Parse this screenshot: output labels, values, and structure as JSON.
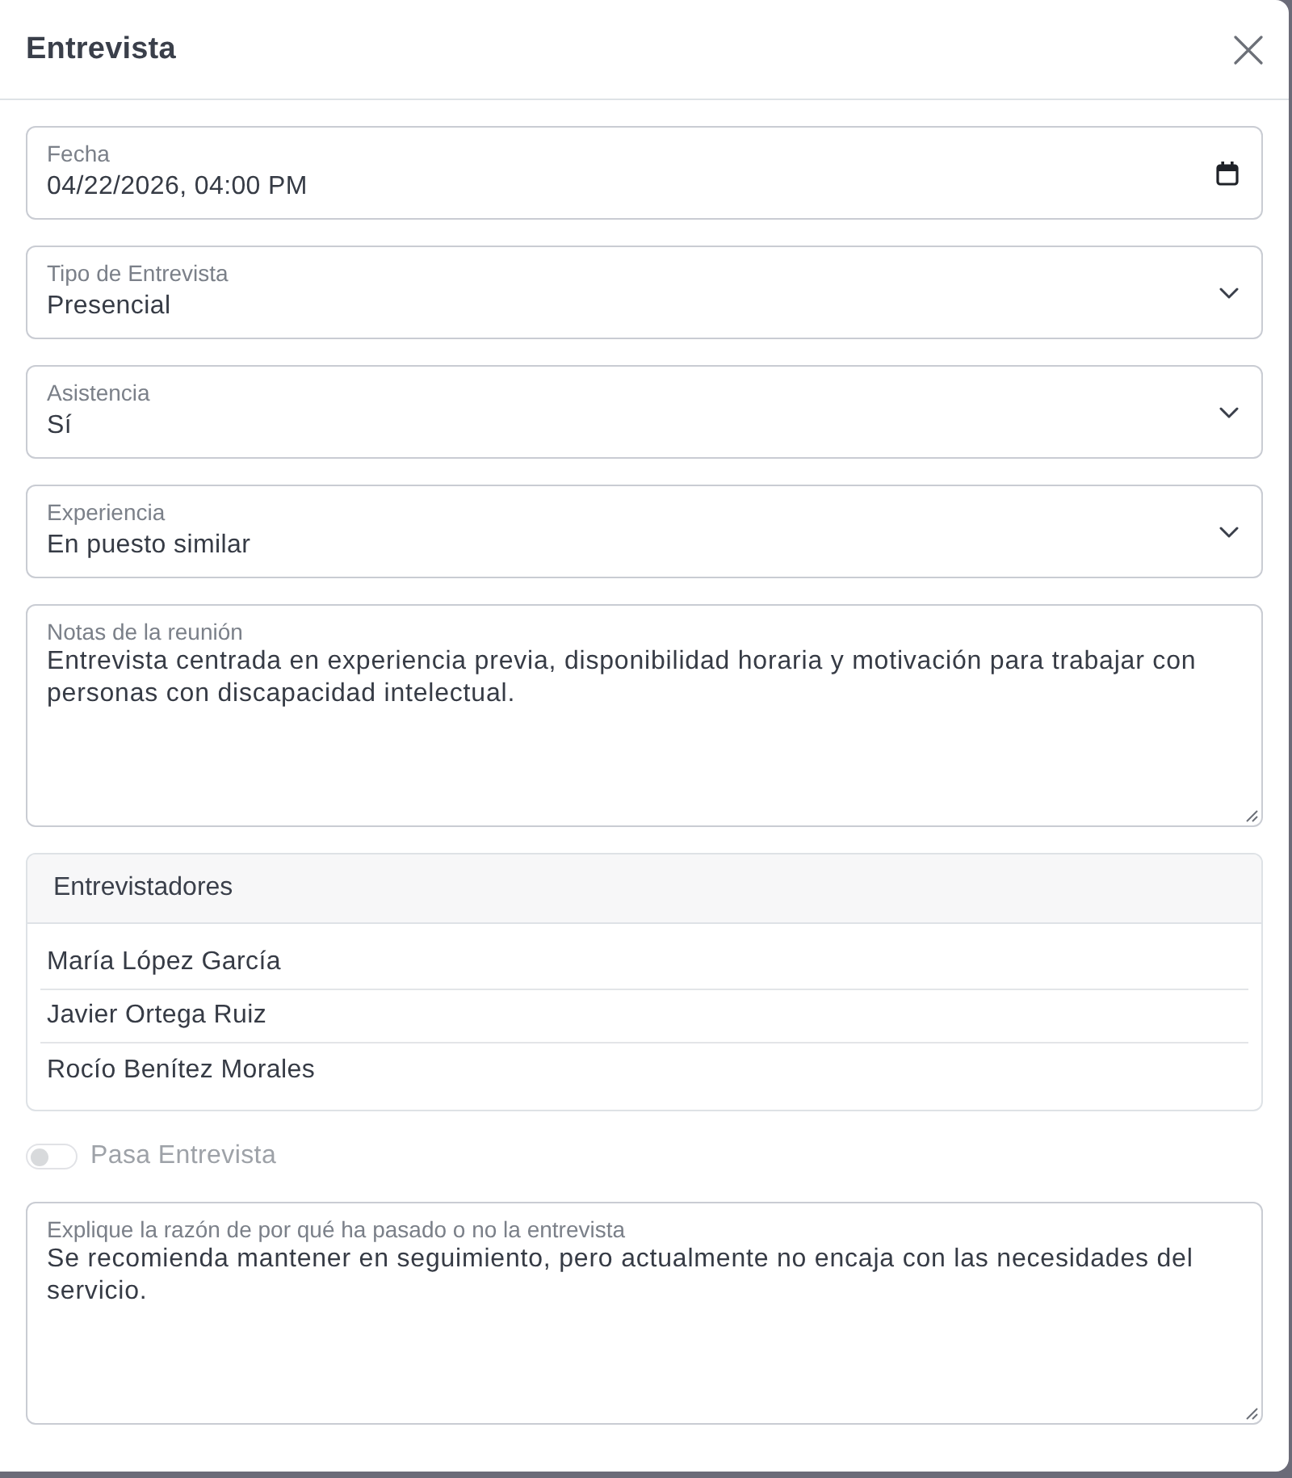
{
  "modal": {
    "title": "Entrevista"
  },
  "fields": [
    {
      "kind": "date",
      "label": "Fecha",
      "value": "04/22/2026, 04:00 PM"
    },
    {
      "kind": "select",
      "label": "Tipo de Entrevista",
      "value": "Presencial"
    },
    {
      "kind": "select",
      "label": "Asistencia",
      "value": "Sí"
    },
    {
      "kind": "select",
      "label": "Experiencia",
      "value": "En puesto similar"
    },
    {
      "kind": "textarea",
      "label": "Notas de la reunión",
      "value": "Entrevista centrada en experiencia previa, disponibilidad horaria y motivación para trabajar con personas con discapacidad intelectual."
    }
  ],
  "interviewers": {
    "title": "Entrevistadores",
    "items": [
      "María López García",
      "Javier Ortega Ruiz",
      "Rocío Benítez Morales"
    ]
  },
  "pass_interview": {
    "label": "Pasa Entrevista",
    "on": false,
    "disabled": true
  },
  "reason": {
    "kind": "textarea",
    "label": "Explique la razón de por qué ha pasado o no la entrevista",
    "value": "Se recomienda mantener en seguimiento, pero actualmente no encaja con las necesidades del servicio."
  }
}
